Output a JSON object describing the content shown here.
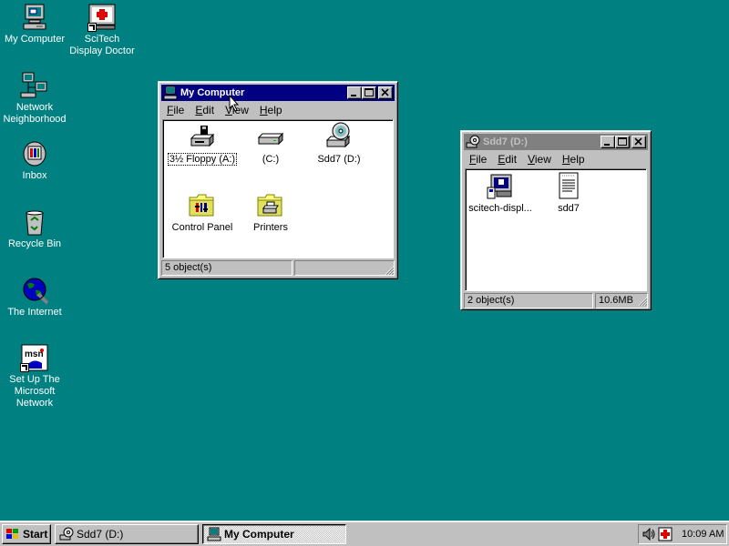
{
  "desktop": {
    "icons": [
      {
        "label": "My Computer"
      },
      {
        "label": "SciTech Display Doctor"
      },
      {
        "label": "Network Neighborhood"
      },
      {
        "label": "Inbox"
      },
      {
        "label": "Recycle Bin"
      },
      {
        "label": "The Internet"
      },
      {
        "label": "Set Up The Microsoft Network"
      }
    ]
  },
  "my_computer_window": {
    "title": "My Computer",
    "menu": [
      "File",
      "Edit",
      "View",
      "Help"
    ],
    "items": [
      {
        "label": "3½ Floppy (A:)",
        "icon": "floppy-drive-icon"
      },
      {
        "label": "(C:)",
        "icon": "hard-drive-icon"
      },
      {
        "label": "Sdd7 (D:)",
        "icon": "cd-drive-icon"
      },
      {
        "label": "Control Panel",
        "icon": "control-panel-folder-icon"
      },
      {
        "label": "Printers",
        "icon": "printers-folder-icon"
      }
    ],
    "status": {
      "count": "5 object(s)",
      "size": ""
    }
  },
  "sdd7_window": {
    "title": "Sdd7 (D:)",
    "menu": [
      "File",
      "Edit",
      "View",
      "Help"
    ],
    "items": [
      {
        "label": "scitech-displ...",
        "icon": "setup-program-icon"
      },
      {
        "label": "sdd7",
        "icon": "text-document-icon"
      }
    ],
    "status": {
      "count": "2 object(s)",
      "size": "10.6MB"
    }
  },
  "taskbar": {
    "start_label": "Start",
    "buttons": [
      {
        "label": "Sdd7 (D:)",
        "pressed": false
      },
      {
        "label": "My Computer",
        "pressed": true
      }
    ],
    "tray": {
      "clock": "10:09 AM",
      "icons": [
        "speaker-icon",
        "display-doctor-tray-icon"
      ]
    }
  },
  "colors": {
    "desktop": "#008080",
    "title_active": "#000080",
    "title_inactive": "#808080",
    "face": "#c0c0c0"
  }
}
